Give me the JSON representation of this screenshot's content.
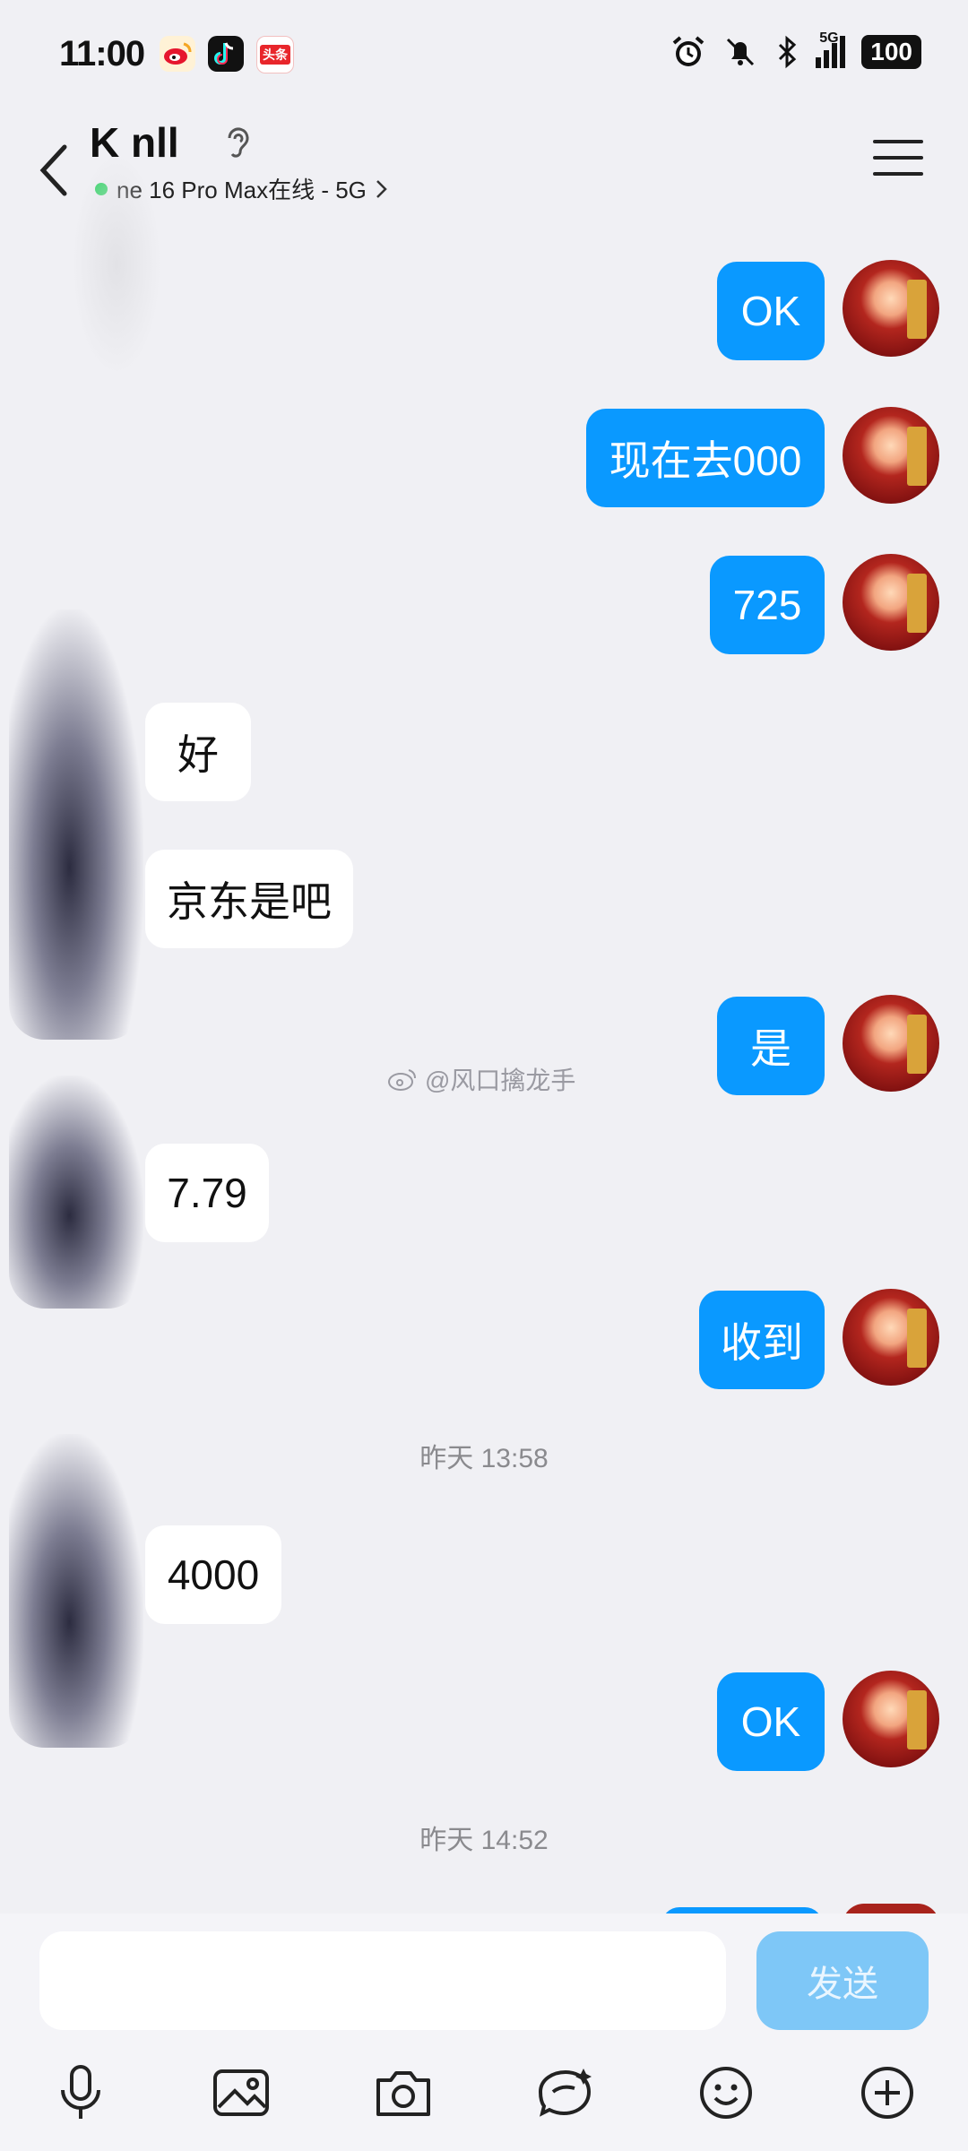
{
  "status_bar": {
    "time": "11:00",
    "app_icons": [
      "weibo-icon",
      "douyin-icon",
      "toutiao-icon"
    ],
    "toutiao_label": "头条",
    "system_icons": [
      "alarm-icon",
      "mute-bell-icon",
      "bluetooth-icon",
      "signal-5g-icon"
    ],
    "network": "5G",
    "battery": "100"
  },
  "header": {
    "name": "K  nll",
    "device_status": "ne 16 Pro Max在线 - 5G",
    "status_color": "#3ad46b"
  },
  "messages": [
    {
      "side": "me",
      "text": "OK"
    },
    {
      "side": "me",
      "text": "现在去000"
    },
    {
      "side": "me",
      "text": "725"
    },
    {
      "side": "them",
      "text": "好"
    },
    {
      "side": "them",
      "text": "京东是吧"
    },
    {
      "side": "me",
      "text": "是"
    },
    {
      "side": "them",
      "text": "7.79"
    },
    {
      "side": "me",
      "text": "收到"
    },
    {
      "side": "time",
      "text": "昨天 13:58"
    },
    {
      "side": "them",
      "text": "4000"
    },
    {
      "side": "me",
      "text": "OK"
    },
    {
      "side": "time",
      "text": "昨天 14:52"
    }
  ],
  "watermark": "@风口擒龙手",
  "input": {
    "value": "",
    "placeholder": "",
    "send_label": "发送"
  },
  "toolbar": [
    "microphone-icon",
    "image-icon",
    "camera-icon",
    "red-packet-icon",
    "emoji-icon",
    "plus-icon"
  ],
  "colors": {
    "accent": "#0a99ff",
    "send_disabled": "#7ec7f7",
    "background": "#f0f0f4"
  }
}
